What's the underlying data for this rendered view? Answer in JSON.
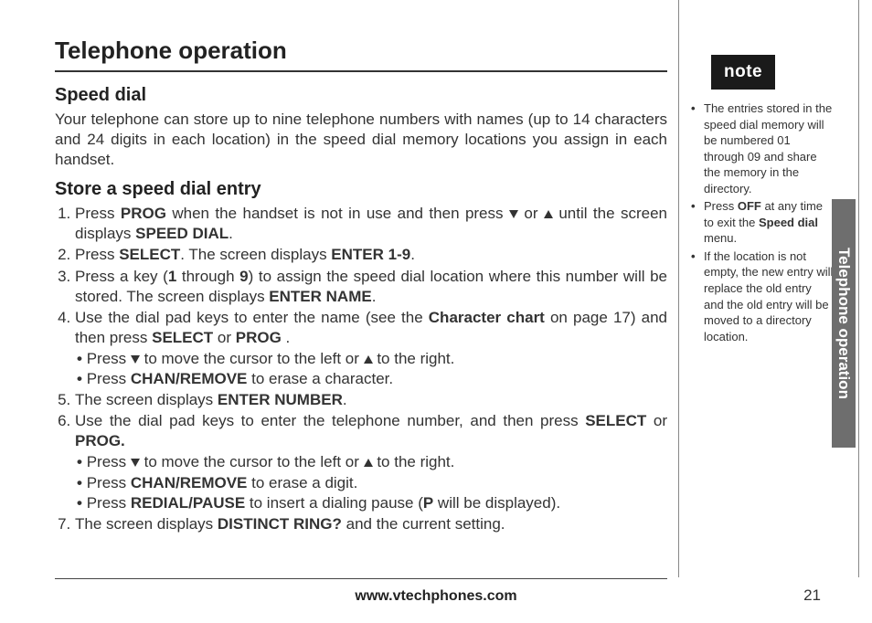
{
  "title": "Telephone operation",
  "sideTab": "Telephone operation",
  "speedDial": {
    "heading": "Speed dial",
    "intro": "Your telephone can store up to nine telephone numbers with names (up to 14 characters and 24 digits in each location) in the speed dial memory locations you assign in each handset."
  },
  "storeEntry": {
    "heading": "Store a speed dial entry",
    "step1_a": "Press ",
    "step1_b": "PROG",
    "step1_c": " when the handset is not in use and then press ",
    "step1_d": " or ",
    "step1_e": "  until the screen displays ",
    "step1_f": "SPEED DIAL",
    "step1_g": ".",
    "step2_a": "Press ",
    "step2_b": "SELECT",
    "step2_c": ". The screen displays ",
    "step2_d": "ENTER 1-9",
    "step2_e": ".",
    "step3_a": "Press a key (",
    "step3_b": "1",
    "step3_c": " through ",
    "step3_d": "9",
    "step3_e": ") to assign the speed dial location where this number will be stored. The screen displays ",
    "step3_f": "ENTER NAME",
    "step3_g": ".",
    "step4_a": "Use the dial pad keys to enter the name (see the ",
    "step4_b": "Character chart",
    "step4_c": " on page 17) and then press ",
    "step4_d": "SELECT",
    "step4_e": " or ",
    "step4_f": "PROG",
    "step4_g": " .",
    "step4_s1_a": "Press ",
    "step4_s1_b": " to move the cursor to the left or ",
    "step4_s1_c": " to the right.",
    "step4_s2_a": "Press ",
    "step4_s2_b": "CHAN/REMOVE",
    "step4_s2_c": " to erase a character.",
    "step5_a": "The screen displays ",
    "step5_b": "ENTER NUMBER",
    "step5_c": ".",
    "step6_a": "Use the dial pad keys to enter the telephone number, and then press ",
    "step6_b": "SELECT",
    "step6_c": " or ",
    "step6_d": "PROG.",
    "step6_s1_a": "Press ",
    "step6_s1_b": " to move the cursor to the left or ",
    "step6_s1_c": " to the right.",
    "step6_s2_a": "Press ",
    "step6_s2_b": "CHAN/REMOVE",
    "step6_s2_c": " to erase a digit.",
    "step6_s3_a": "Press ",
    "step6_s3_b": "REDIAL/PAUSE",
    "step6_s3_c": " to insert a dialing pause (",
    "step6_s3_d": "P",
    "step6_s3_e": " will be displayed).",
    "step7_a": "The screen displays ",
    "step7_b": "DISTINCT RING?",
    "step7_c": " and the current setting."
  },
  "noteBadge": "note",
  "notes": {
    "n1": "The entries stored in the speed dial memory will be numbered 01 through 09 and share the memory in the directory.",
    "n2_a": "Press ",
    "n2_b": "OFF",
    "n2_c": " at any time to exit the ",
    "n2_d": "Speed dial",
    "n2_e": " menu.",
    "n3": "If the location is not empty, the new entry will replace the old entry and the old entry will be moved to a directory location."
  },
  "footer": "www.vtechphones.com",
  "pageNumber": "21"
}
